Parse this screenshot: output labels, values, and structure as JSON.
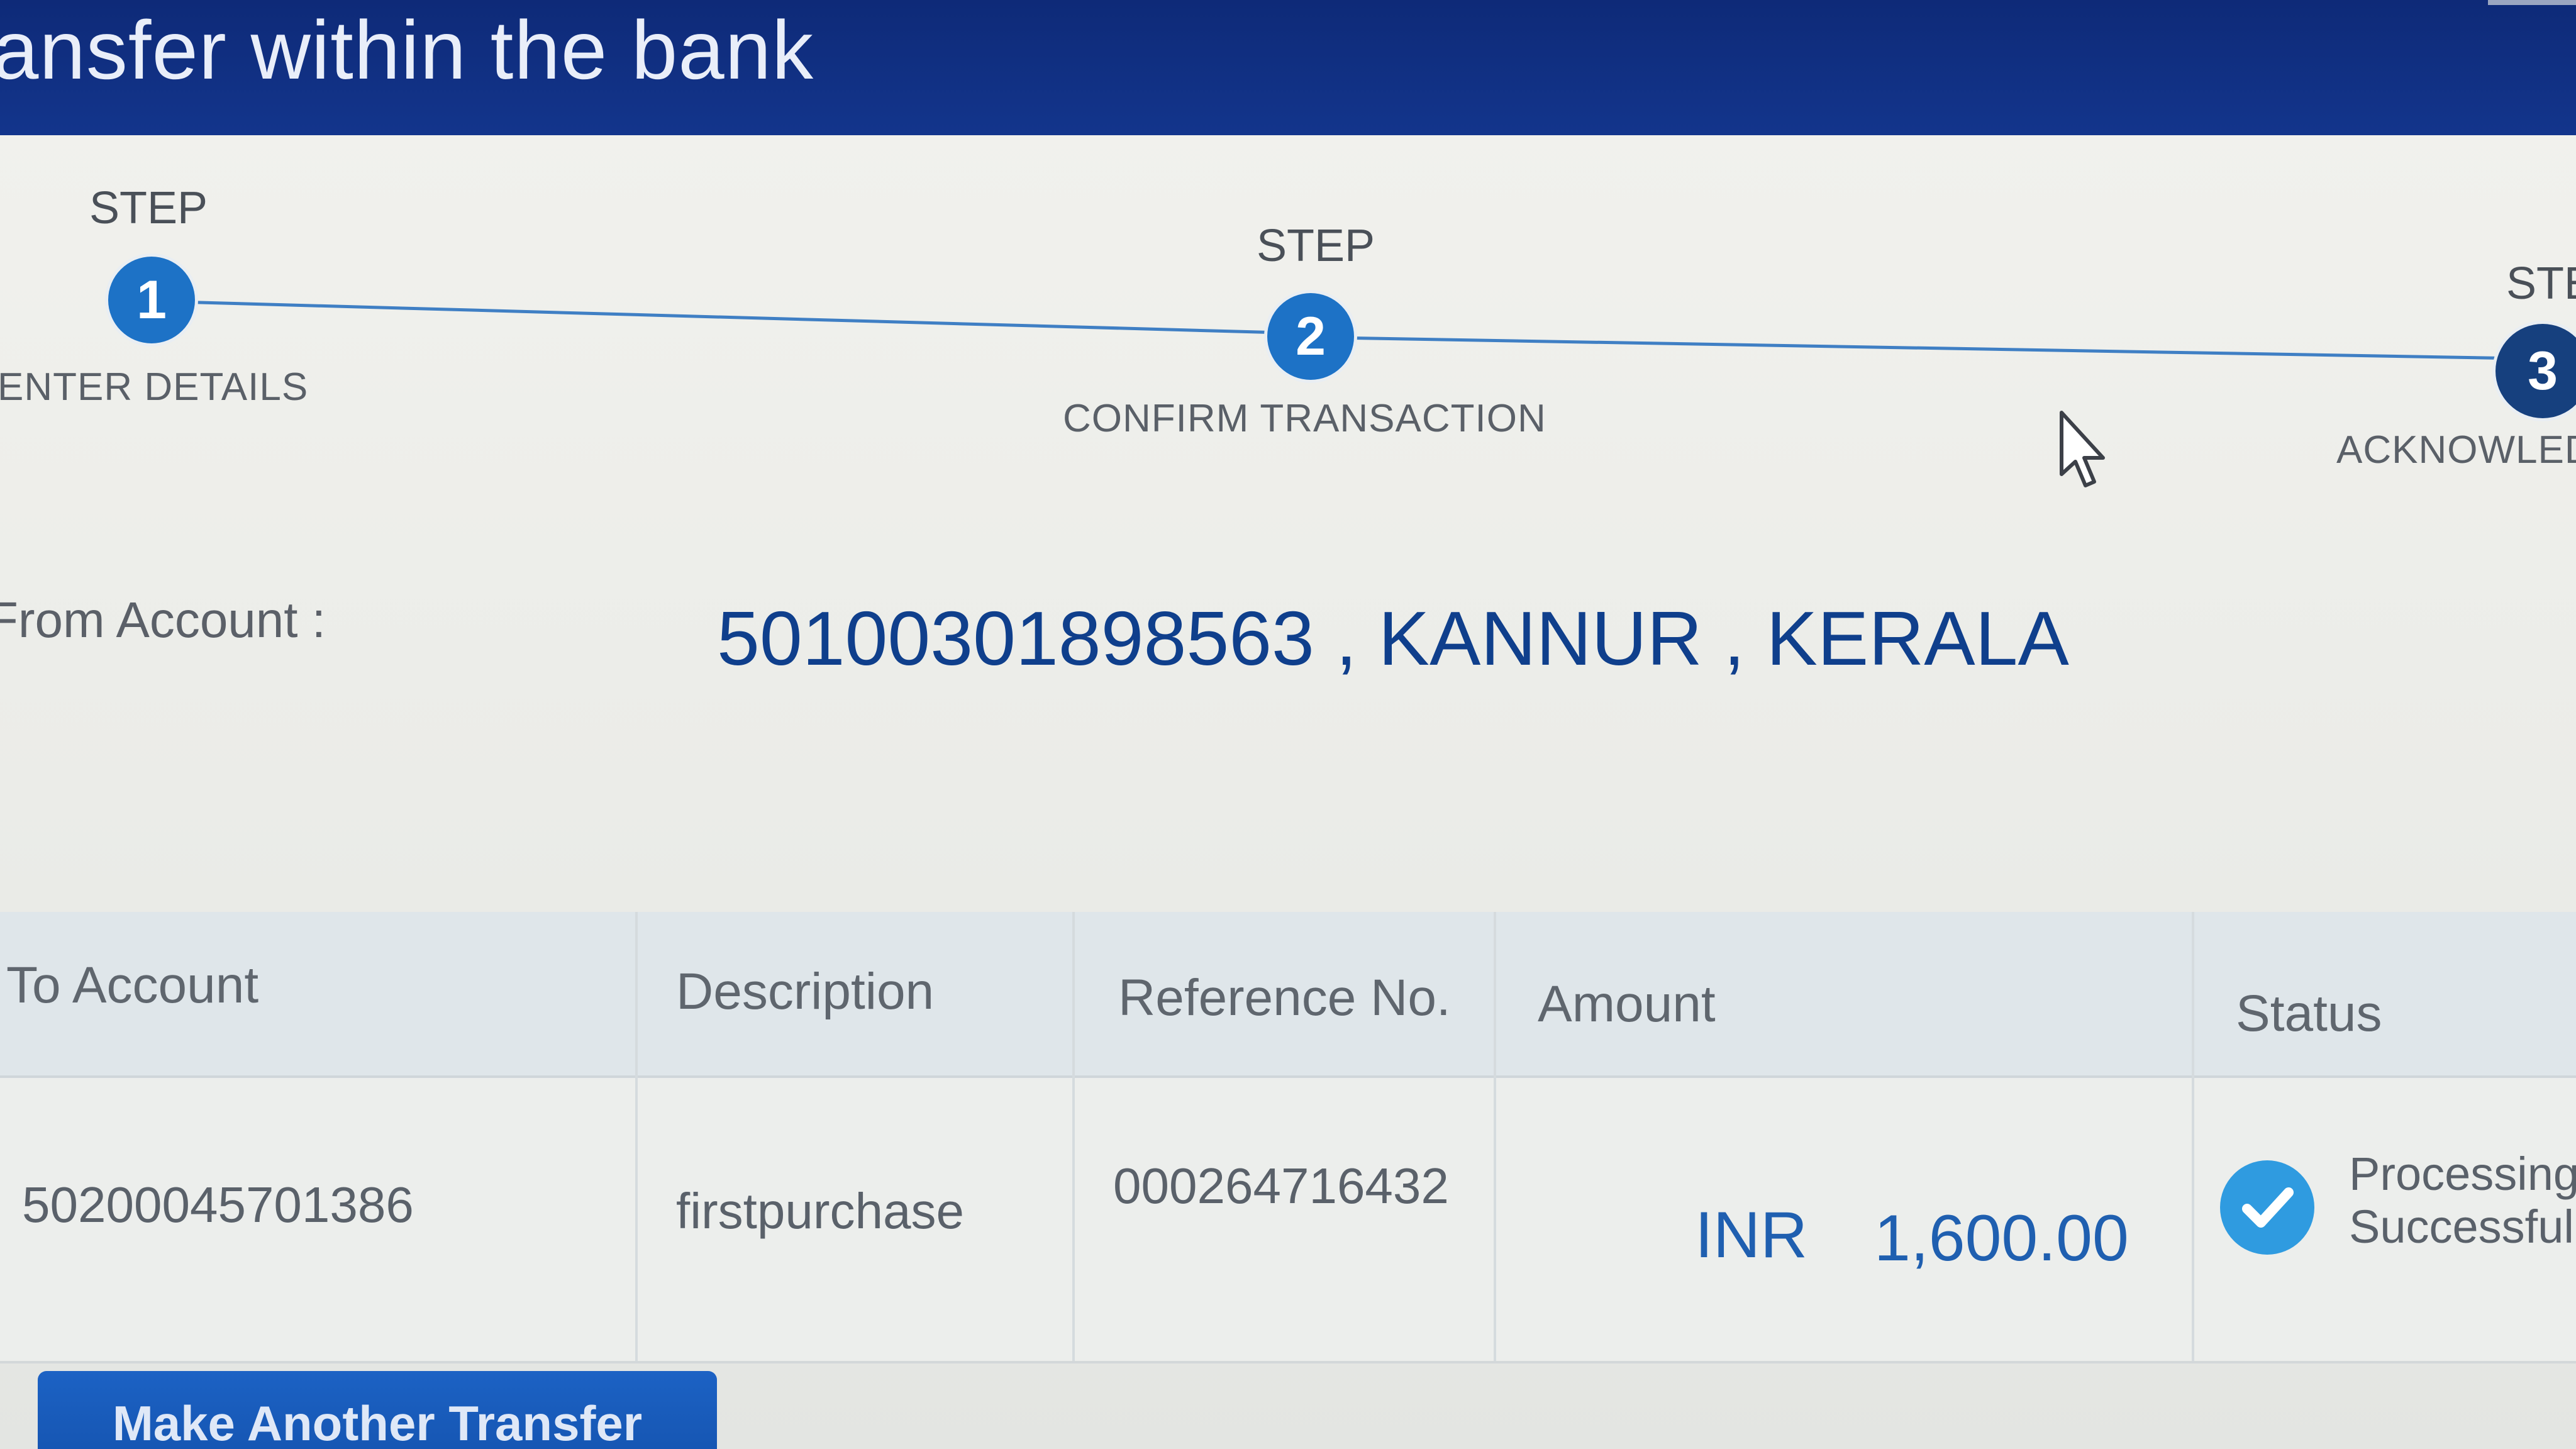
{
  "header": {
    "title": "ansfer within the bank"
  },
  "stepper": {
    "steps": [
      {
        "head": "STEP",
        "number": "1",
        "label": "ENTER DETAILS"
      },
      {
        "head": "STEP",
        "number": "2",
        "label": "CONFIRM TRANSACTION"
      },
      {
        "head": "STE",
        "number": "3",
        "label": "ACKNOWLED"
      }
    ]
  },
  "from_account": {
    "label": "From Account :",
    "value": "50100301898563 , KANNUR , KERALA"
  },
  "table": {
    "headers": [
      "To Account",
      "Description",
      "Reference No.",
      "Amount",
      "Status"
    ],
    "row": {
      "to_account": "50200045701386",
      "description": "firstpurchase",
      "reference_no": "000264716432",
      "amount_currency": "INR",
      "amount_value": "1,600.00",
      "status_line1": "Processing",
      "status_line2": "Successful",
      "status_icon": "check-circle-icon"
    }
  },
  "actions": {
    "make_another_transfer": "Make Another Transfer"
  },
  "colors": {
    "header_bg": "#0e2a78",
    "accent_blue": "#1d72c6",
    "success": "#2f9be0"
  }
}
